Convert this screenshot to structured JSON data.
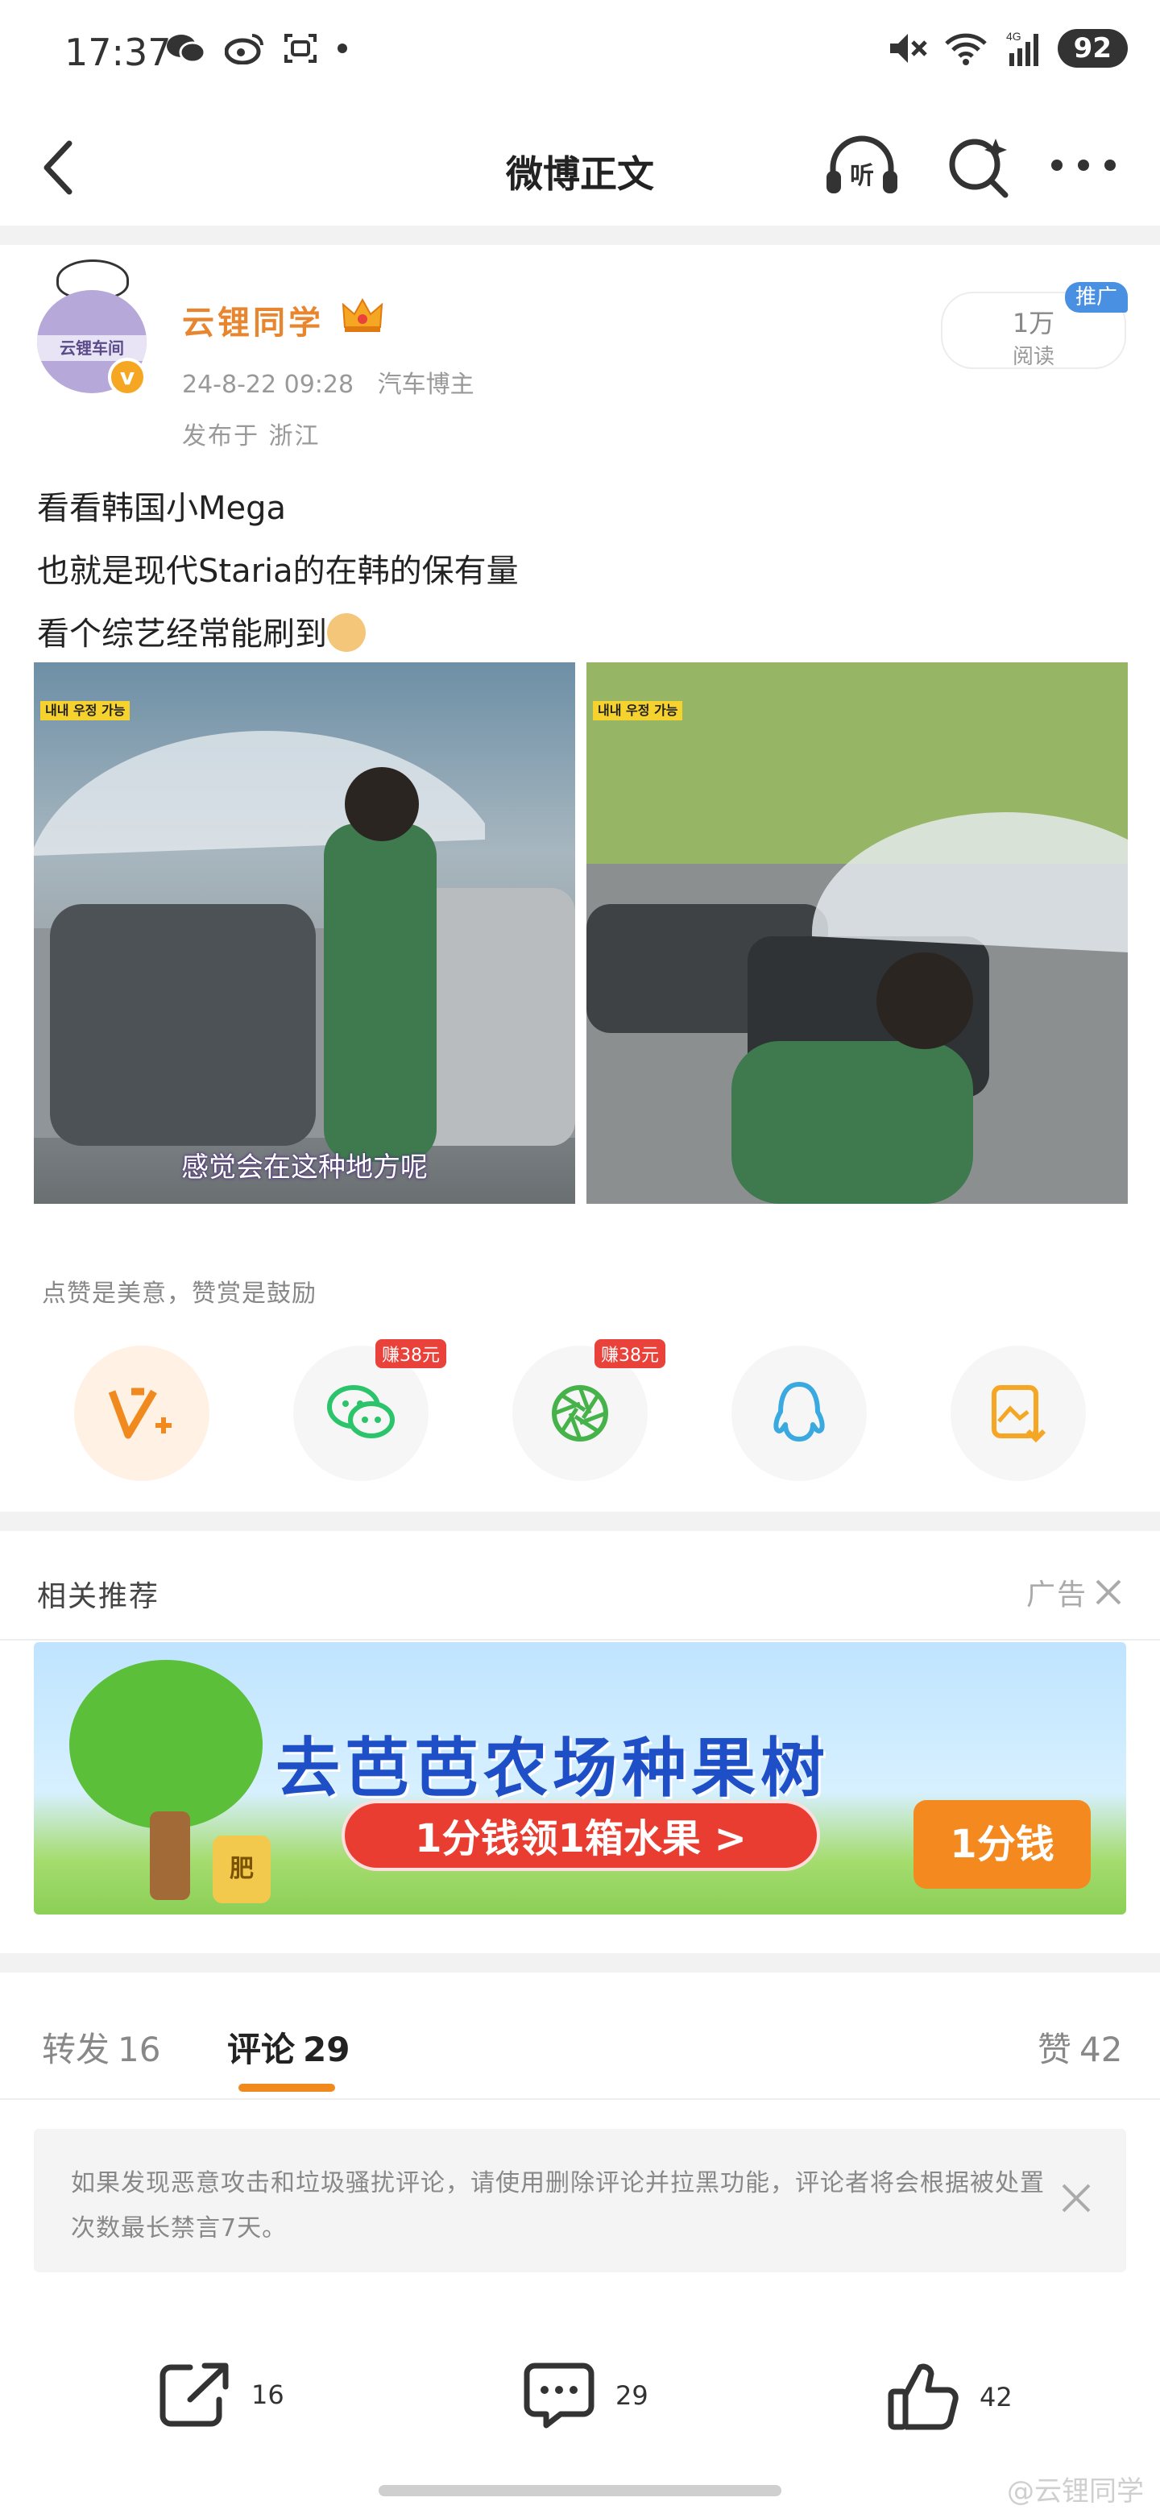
{
  "status_bar": {
    "time": "17:37",
    "network": "4G",
    "wifi_label": "6",
    "battery": "92"
  },
  "nav": {
    "title": "微博正文",
    "listen_label": "听"
  },
  "post": {
    "author": "云锂同学",
    "avatar_text": "云锂车间",
    "date": "24-8-22 09:28",
    "source": "汽车博主",
    "location": "发布于 浙江",
    "read_count": "1万",
    "read_label": "阅读",
    "promo_badge": "推广",
    "lines": [
      "看看韩国小Mega",
      "也就是现代Staria的在韩的保有量",
      "看个综艺经常能刷到"
    ],
    "images": [
      {
        "subtitle": "感觉会在这种地方呢",
        "tag": "내내 우정 가능"
      },
      {
        "subtitle": "",
        "tag": "내내 우정 가능"
      }
    ]
  },
  "reward": {
    "note": "点赞是美意，赞赏是鼓励",
    "earn_badge": "赚38元"
  },
  "recommend": {
    "title": "相关推荐",
    "ad_label": "广告"
  },
  "ad": {
    "headline": "去芭芭农场种果树",
    "pill": "1分钱领1箱水果 >",
    "price": "1分钱",
    "bag_text": "肥"
  },
  "tabs": {
    "repost": {
      "label": "转发",
      "count": "16"
    },
    "comment": {
      "label": "评论",
      "count": "29"
    },
    "like": {
      "label": "赞",
      "count": "42"
    }
  },
  "notice": {
    "text": "如果发现恶意攻击和垃圾骚扰评论，请使用删除评论并拉黑功能，评论者将会根据被处置次数最长禁言7天。"
  },
  "bottom_bar": {
    "repost_count": "16",
    "comment_count": "29",
    "like_count": "42"
  },
  "watermark": "@云锂同学",
  "colors": {
    "accent": "#f08a1e",
    "username": "#e8852f",
    "wechat": "#2bc46a",
    "moments": "#45b34a",
    "qq": "#3aa9e0",
    "save": "#f5a623"
  }
}
